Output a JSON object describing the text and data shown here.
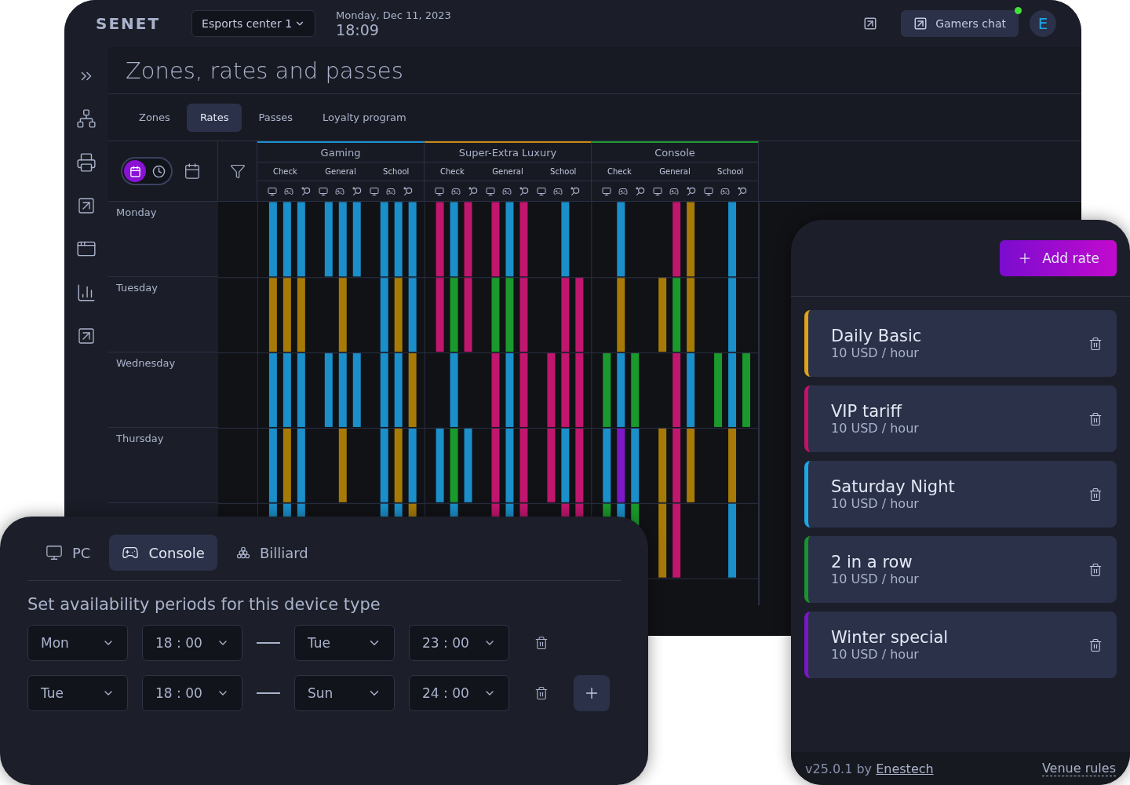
{
  "header": {
    "logo": "SENET",
    "venue_select": "Esports center 1",
    "date": "Monday, Dec 11, 2023",
    "time": "18:09",
    "chat_button": "Gamers chat",
    "chat_online": true,
    "avatar": "E"
  },
  "page_title": "Zones, rates and passes",
  "tabs": [
    {
      "label": "Zones",
      "selected": false
    },
    {
      "label": "Rates",
      "selected": true
    },
    {
      "label": "Passes",
      "selected": false
    },
    {
      "label": "Loyalty program",
      "selected": false
    }
  ],
  "view_toggle": [
    {
      "kind": "calendar",
      "selected": true
    },
    {
      "kind": "clock",
      "selected": false
    }
  ],
  "zones": [
    {
      "name": "Gaming",
      "color": "#1e8fd0",
      "rates": [
        "Check",
        "General",
        "School"
      ]
    },
    {
      "name": "Super-Extra Luxury",
      "color": "#c98a12",
      "rates": [
        "Check",
        "General",
        "School"
      ]
    },
    {
      "name": "Console",
      "color": "#1f9a32",
      "rates": [
        "Check",
        "General",
        "School"
      ]
    }
  ],
  "days": [
    "Monday",
    "Tuesday",
    "Wednesday",
    "Thursday"
  ],
  "device_panel": {
    "tabs": [
      {
        "label": "PC",
        "kind": "pc",
        "selected": false
      },
      {
        "label": "Console",
        "kind": "console",
        "selected": true
      },
      {
        "label": "Billiard",
        "kind": "billiard",
        "selected": false
      }
    ],
    "heading": "Set availability periods for this device type",
    "periods": [
      {
        "from_day": "Mon",
        "from_time": "18 : 00",
        "to_day": "Tue",
        "to_time": "23 : 00"
      },
      {
        "from_day": "Tue",
        "from_time": "18 : 00",
        "to_day": "Sun",
        "to_time": "24 : 00"
      }
    ]
  },
  "rates_panel": {
    "add_button": "Add rate",
    "rates": [
      {
        "name": "Daily Basic",
        "price": "10 USD / hour",
        "color": "#e0a21c"
      },
      {
        "name": "VIP tariff",
        "price": "10 USD / hour",
        "color": "#c4126a"
      },
      {
        "name": "Saturday Night",
        "price": "10 USD / hour",
        "color": "#1ea8e8"
      },
      {
        "name": "2 in a row",
        "price": "10 USD / hour",
        "color": "#18952c"
      },
      {
        "name": "Winter special",
        "price": "10 USD / hour",
        "color": "#7b16c8"
      }
    ],
    "footer": {
      "credit": "v25.0.1 by",
      "author_link": "Enestech",
      "venue_rules": "Venue rules"
    }
  }
}
